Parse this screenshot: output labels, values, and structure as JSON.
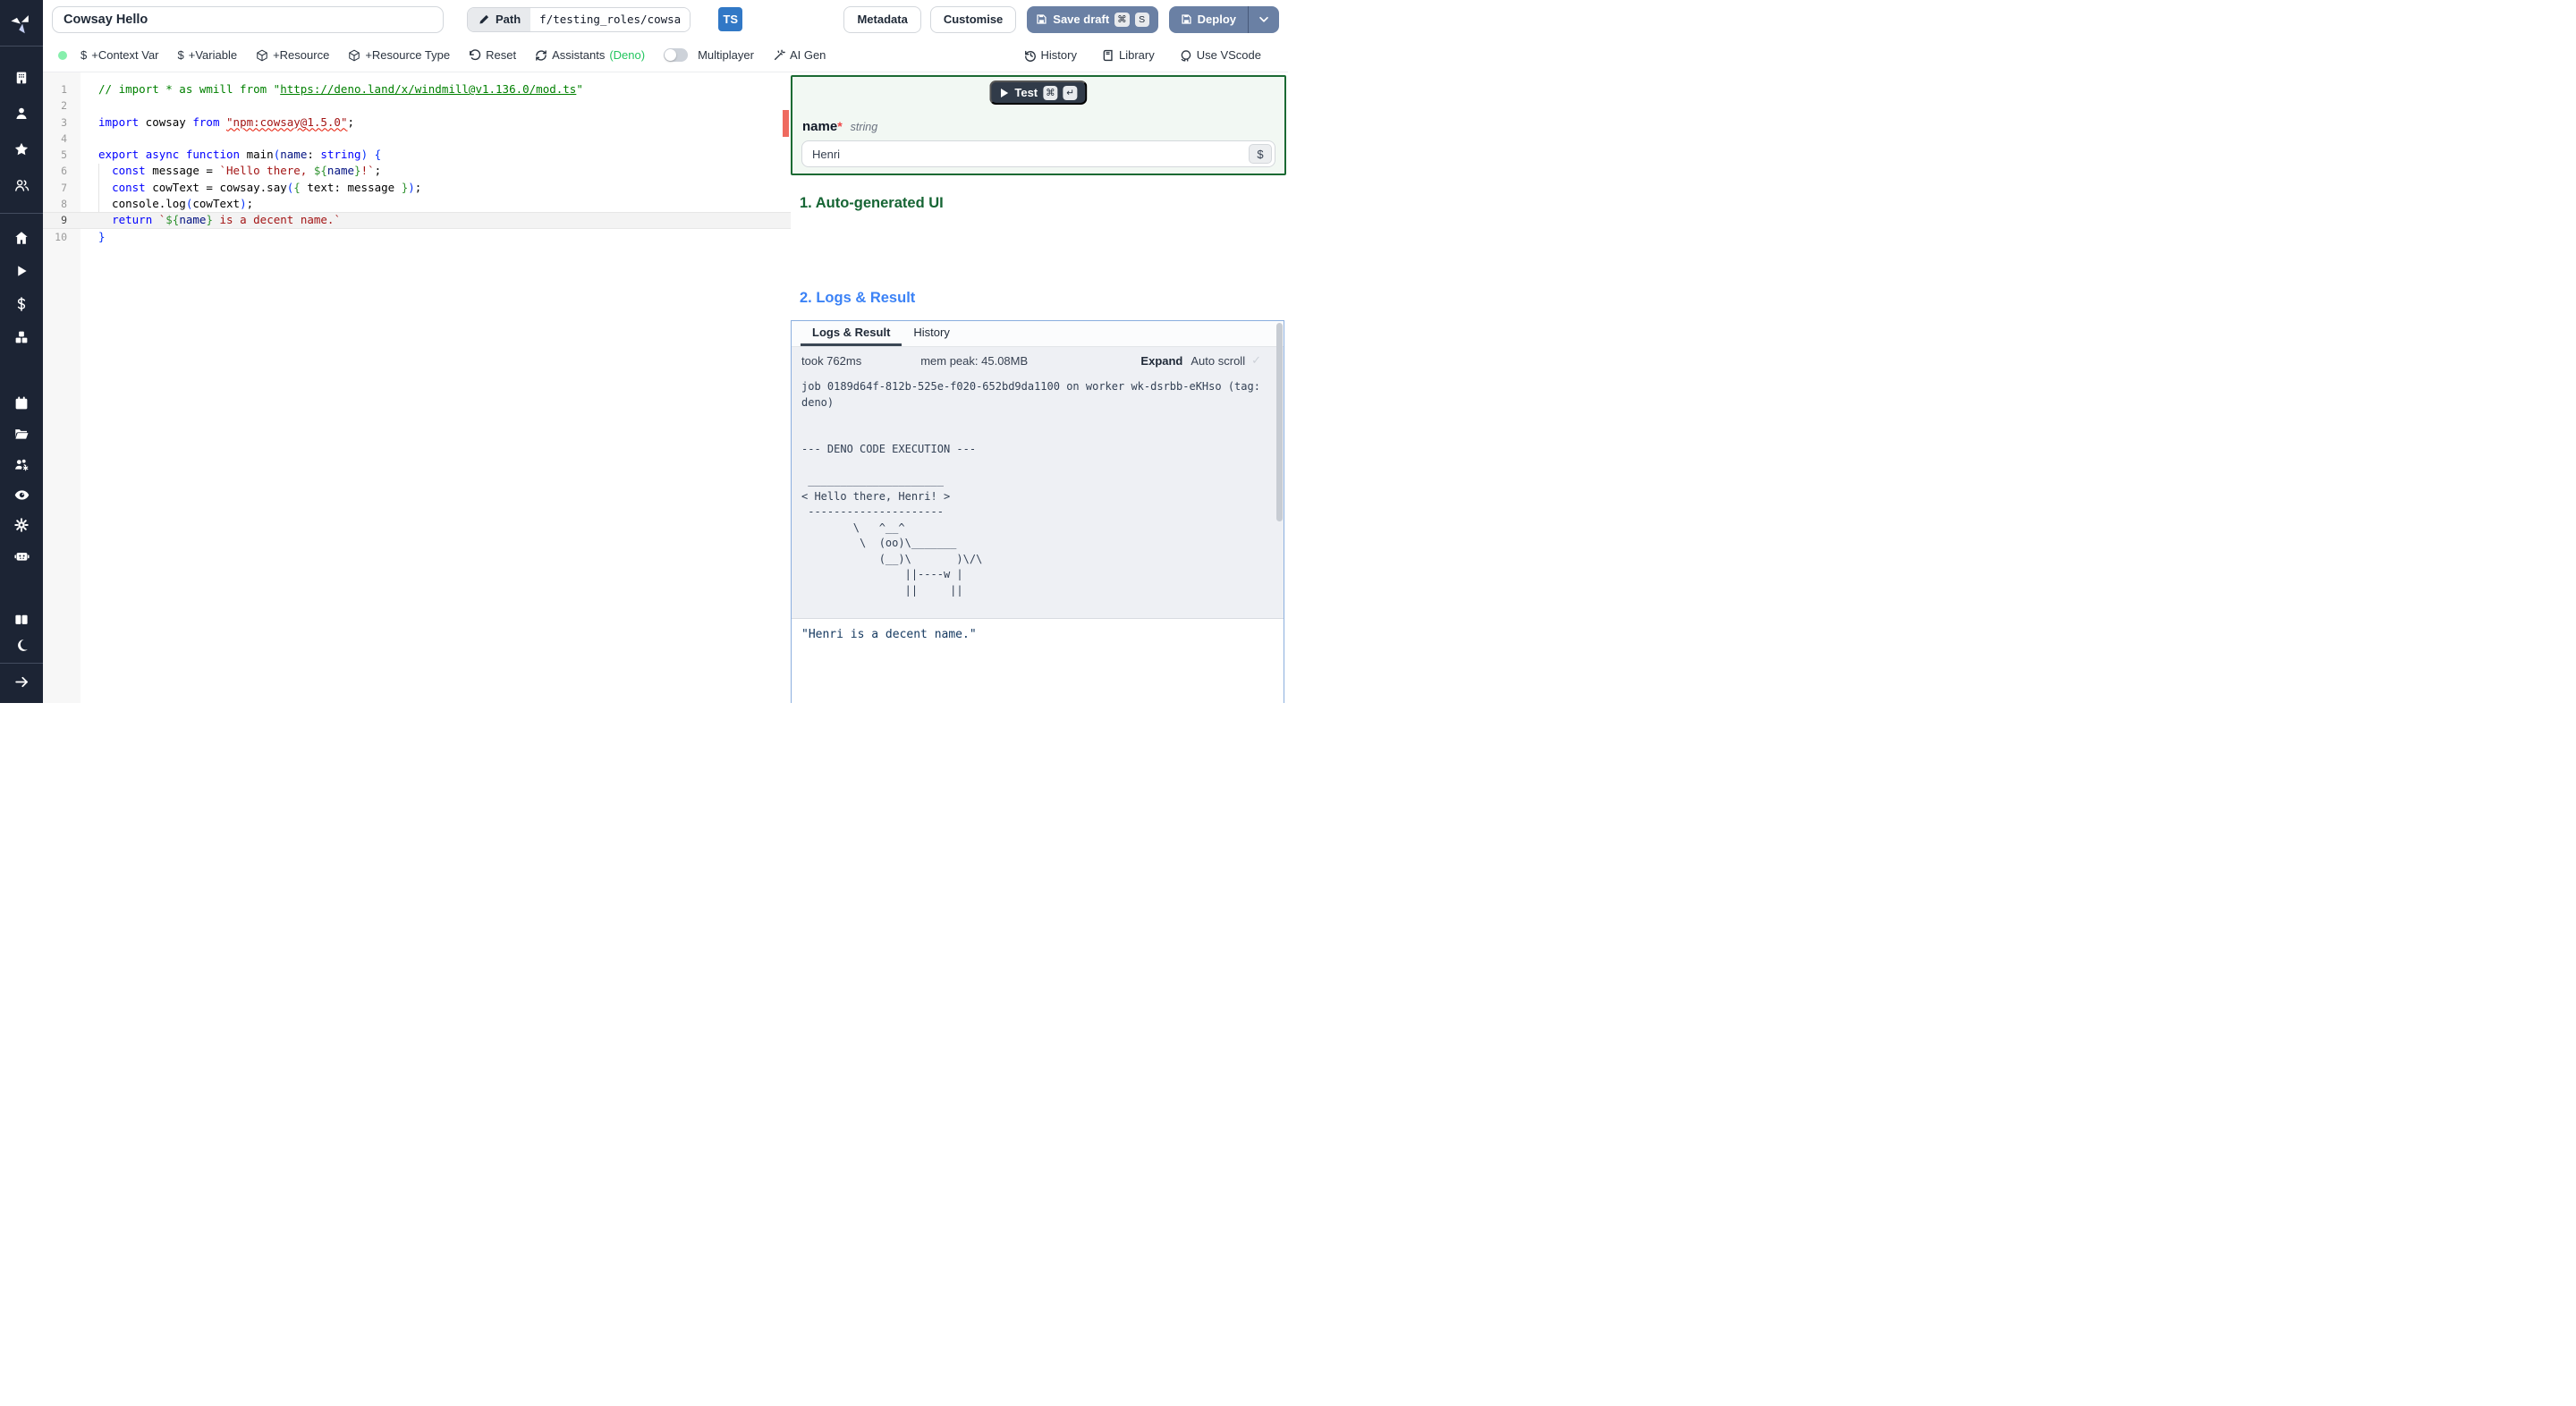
{
  "topbar": {
    "title": "Cowsay Hello",
    "path_label": "Path",
    "path_value": "f/testing_roles/cowsa",
    "lang_badge": "TS",
    "metadata": "Metadata",
    "customise": "Customise",
    "save_draft": "Save draft",
    "save_key_1": "⌘",
    "save_key_2": "S",
    "deploy": "Deploy"
  },
  "toolbar": {
    "dollar": "$",
    "context_var": "+Context Var",
    "variable": "+Variable",
    "resource": "+Resource",
    "resource_type": "+Resource Type",
    "reset": "Reset",
    "assistants": "Assistants",
    "assistants_lang": "(Deno)",
    "multiplayer": "Multiplayer",
    "ai_gen": "AI Gen",
    "history": "History",
    "library": "Library",
    "vscode": "Use VScode"
  },
  "sidebar": {
    "icons": [
      "windmill-logo",
      "building",
      "user",
      "star",
      "users",
      "home",
      "play",
      "dollar-sign",
      "boxes",
      "calendar",
      "folder-open",
      "users-gear",
      "eye",
      "gear",
      "robot",
      "book",
      "moon",
      "arrow-right"
    ]
  },
  "editor": {
    "current_line": 9,
    "lines": [
      {
        "n": 1,
        "t": [
          [
            "// import * as wmill from \"",
            "cm"
          ],
          [
            "https://deno.land/x/windmill@v1.136.0/mod.ts",
            "cm u"
          ],
          [
            "\"",
            "cm"
          ]
        ]
      },
      {
        "n": 2,
        "t": []
      },
      {
        "n": 3,
        "t": [
          [
            "import",
            "kw"
          ],
          [
            " cowsay ",
            "df"
          ],
          [
            "from",
            "kw"
          ],
          [
            " ",
            "df"
          ],
          [
            "\"npm:cowsay@1.5.0\"",
            "str sq"
          ],
          [
            ";",
            "df"
          ]
        ]
      },
      {
        "n": 4,
        "t": []
      },
      {
        "n": 5,
        "t": [
          [
            "export",
            "kw"
          ],
          [
            " ",
            "df"
          ],
          [
            "async",
            "kw"
          ],
          [
            " ",
            "df"
          ],
          [
            "function",
            "kw"
          ],
          [
            " main",
            "df"
          ],
          [
            "(",
            "b1"
          ],
          [
            "name",
            "pr"
          ],
          [
            ": ",
            "df"
          ],
          [
            "string",
            "kw"
          ],
          [
            ")",
            "b1"
          ],
          [
            " ",
            "df"
          ],
          [
            "{",
            "b1"
          ]
        ]
      },
      {
        "n": 6,
        "t": [
          [
            "  ",
            "df"
          ],
          [
            "const",
            "kw"
          ],
          [
            " message = ",
            "df"
          ],
          [
            "`Hello there, ",
            "str"
          ],
          [
            "${",
            "b2"
          ],
          [
            "name",
            "pr"
          ],
          [
            "}",
            "b2"
          ],
          [
            "!`",
            "str"
          ],
          [
            ";",
            "df"
          ]
        ]
      },
      {
        "n": 7,
        "t": [
          [
            "  ",
            "df"
          ],
          [
            "const",
            "kw"
          ],
          [
            " cowText = cowsay.say",
            "df"
          ],
          [
            "(",
            "b1"
          ],
          [
            "{",
            "b2"
          ],
          [
            " text: message ",
            "df"
          ],
          [
            "}",
            "b2"
          ],
          [
            ")",
            "b1"
          ],
          [
            ";",
            "df"
          ]
        ]
      },
      {
        "n": 8,
        "t": [
          [
            "  console.log",
            "df"
          ],
          [
            "(",
            "b1"
          ],
          [
            "cowText",
            "df"
          ],
          [
            ")",
            "b1"
          ],
          [
            ";",
            "df"
          ]
        ]
      },
      {
        "n": 9,
        "t": [
          [
            "  ",
            "df"
          ],
          [
            "return",
            "kw"
          ],
          [
            " ",
            "df"
          ],
          [
            "`",
            "str"
          ],
          [
            "${",
            "b2"
          ],
          [
            "name",
            "pr"
          ],
          [
            "}",
            "b2"
          ],
          [
            " is a decent name.`",
            "str"
          ]
        ]
      },
      {
        "n": 10,
        "t": [
          [
            "}",
            "b1"
          ]
        ]
      }
    ]
  },
  "form": {
    "test": "Test",
    "test_key_1": "⌘",
    "test_key_2": "↵",
    "field_name": "name",
    "required_mark": "*",
    "field_type": "string",
    "value": "Henri",
    "var_picker": "$"
  },
  "sections": {
    "auto_ui": "1. Auto-generated UI",
    "logs_result": "2. Logs & Result"
  },
  "logs": {
    "tab_active": "Logs & Result",
    "tab_history": "History",
    "took": "took 762ms",
    "mem": "mem peak: 45.08MB",
    "expand": "Expand",
    "autoscroll": "Auto scroll",
    "check": "✓",
    "log_lines": [
      "job 0189d64f-812b-525e-f020-652bd9da1100 on worker wk-dsrbb-eKHso (tag:",
      "deno)",
      "",
      "",
      "--- DENO CODE EXECUTION ---",
      "",
      " _____________________",
      "< Hello there, Henri! >",
      " ---------------------",
      "        \\   ^__^",
      "         \\  (oo)\\_______",
      "            (__)\\       )\\/\\",
      "                ||----w |",
      "                ||     ||"
    ],
    "result": "\"Henri is a decent name.\""
  },
  "colors": {
    "accent_slate": "#6a80a4",
    "ts_badge": "#3178c6",
    "status_dot": "#86efac",
    "deno_green": "#22c55e",
    "green_border": "#1b6a33",
    "green_heading": "#166534",
    "blue_heading": "#3b82f6",
    "logs_border": "#8aaede",
    "error_marker": "#ef6a5f"
  }
}
